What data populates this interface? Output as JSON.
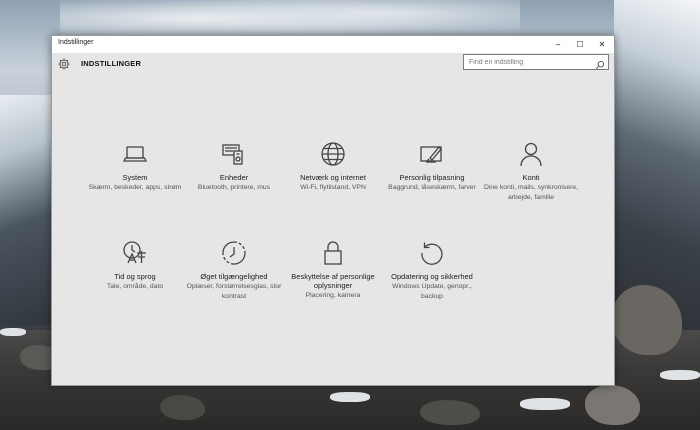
{
  "window": {
    "title": "Indstillinger",
    "controls": {
      "minimize": "–",
      "maximize": "☐",
      "close": "✕"
    }
  },
  "header": {
    "icon": "gear-icon",
    "title": "INDSTILLINGER"
  },
  "search": {
    "placeholder": "Find en indstilling",
    "value": "",
    "icon": "search-icon"
  },
  "categories": [
    {
      "icon": "laptop-icon",
      "name": "System",
      "desc": "Skærm, beskeder, apps, strøm"
    },
    {
      "icon": "devices-icon",
      "name": "Enheder",
      "desc": "Bluetooth, printere, mus"
    },
    {
      "icon": "globe-icon",
      "name": "Netværk og internet",
      "desc": "Wi-Fi, flytilstand, VPN"
    },
    {
      "icon": "personalization-icon",
      "name": "Personlig tilpasning",
      "desc": "Baggrund, låseskærm, farver"
    },
    {
      "icon": "person-icon",
      "name": "Konti",
      "desc": "Dine konti, mails, synkronisere, arbejde, familie"
    },
    {
      "icon": "time-language-icon",
      "name": "Tid og sprog",
      "desc": "Tale, område, dato"
    },
    {
      "icon": "ease-of-access-icon",
      "name": "Øget tilgængelighed",
      "desc": "Oplæser, forstørrelsesglas, stor kontrast"
    },
    {
      "icon": "lock-icon",
      "name": "Beskyttelse af personlige oplysninger",
      "desc": "Placering, kamera"
    },
    {
      "icon": "update-icon",
      "name": "Opdatering og sikkerhed",
      "desc": "Windows Update, genopr., backup"
    }
  ],
  "colors": {
    "window_bg": "#e6e6e6",
    "titlebar_bg": "#ffffff",
    "icon_stroke": "#444444"
  }
}
